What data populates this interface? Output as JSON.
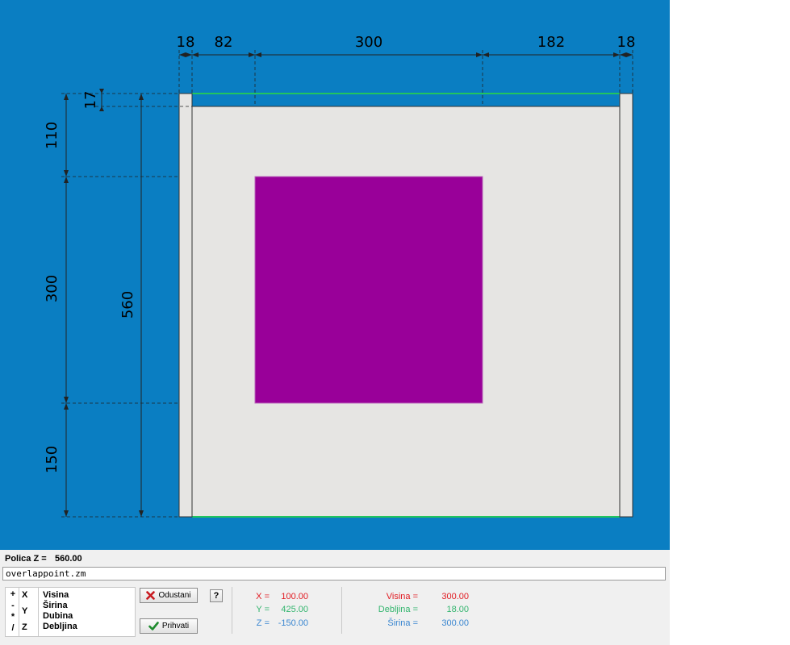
{
  "drawing": {
    "dims_top": [
      "18",
      "82",
      "300",
      "182",
      "18"
    ],
    "dims_left": [
      "17",
      "110",
      "300",
      "150"
    ],
    "dim_total": "560"
  },
  "status": {
    "label": "Polica Z =",
    "value": "560.00"
  },
  "command": {
    "value": "overlappoint.zm"
  },
  "operators": {
    "symbols": [
      "+",
      "-",
      "*",
      "/"
    ],
    "axes": [
      "X",
      "Y",
      "Z"
    ],
    "props": [
      "Visina",
      "Širina",
      "Dubina",
      "Debljina"
    ]
  },
  "buttons": {
    "cancel": "Odustani",
    "accept": "Prihvati",
    "help": "?"
  },
  "coords": {
    "x_label": "X =",
    "x_value": "100.00",
    "y_label": "Y =",
    "y_value": "425.00",
    "z_label": "Z =",
    "z_value": "-150.00"
  },
  "props": {
    "visina_label": "Visina =",
    "visina_value": "300.00",
    "debljina_label": "Debljina =",
    "debljina_value": "18.00",
    "sirina_label": "Širina =",
    "sirina_value": "300.00"
  },
  "colors": {
    "background": "#0a7ec2",
    "panel": "#e6e5e3",
    "shelf": "#990099",
    "edge": "#22c55e"
  }
}
